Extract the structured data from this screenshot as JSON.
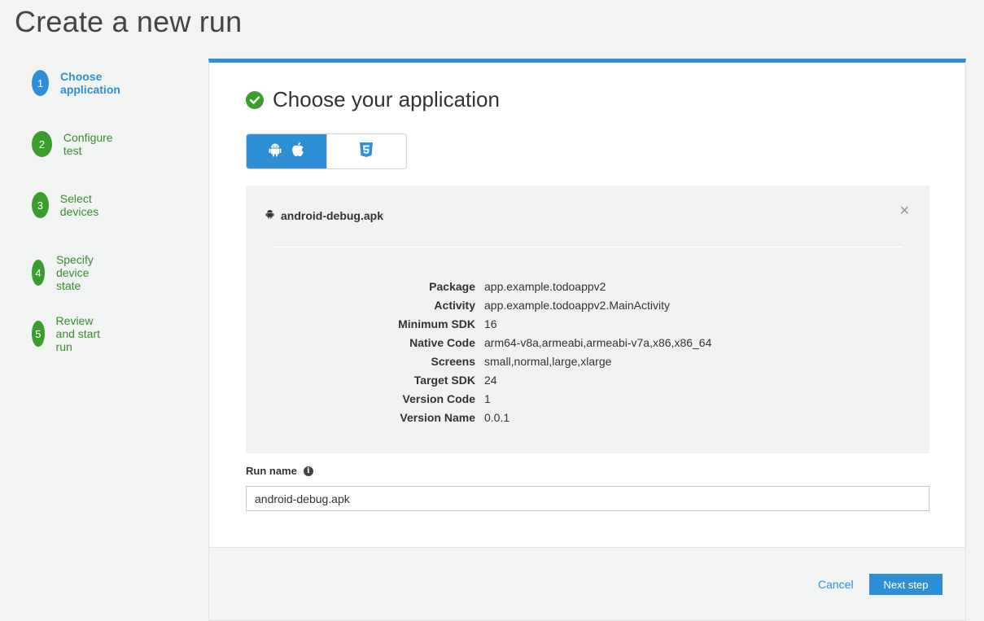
{
  "page": {
    "title": "Create a new run"
  },
  "steps": [
    {
      "number": "1",
      "label": "Choose application",
      "state": "active"
    },
    {
      "number": "2",
      "label": "Configure test",
      "state": "complete"
    },
    {
      "number": "3",
      "label": "Select devices",
      "state": "complete"
    },
    {
      "number": "4",
      "label": "Specify device state",
      "state": "complete"
    },
    {
      "number": "5",
      "label": "Review and start run",
      "state": "complete"
    }
  ],
  "main": {
    "title": "Choose your application",
    "title_icon": "check-circle-icon",
    "platform_toggle": {
      "options": [
        {
          "icons": [
            "android-icon",
            "apple-icon"
          ],
          "selected": true
        },
        {
          "icons": [
            "html5-icon"
          ],
          "selected": false
        }
      ]
    },
    "app": {
      "file_name": "android-debug.apk",
      "file_icon": "android-icon",
      "details": [
        {
          "key": "Package",
          "value": "app.example.todoappv2"
        },
        {
          "key": "Activity",
          "value": "app.example.todoappv2.MainActivity"
        },
        {
          "key": "Minimum SDK",
          "value": "16"
        },
        {
          "key": "Native Code",
          "value": "arm64-v8a,armeabi,armeabi-v7a,x86,x86_64"
        },
        {
          "key": "Screens",
          "value": "small,normal,large,xlarge"
        },
        {
          "key": "Target SDK",
          "value": "24"
        },
        {
          "key": "Version Code",
          "value": "1"
        },
        {
          "key": "Version Name",
          "value": "0.0.1"
        }
      ]
    },
    "run_name": {
      "label": "Run name",
      "info_glyph": "i",
      "value": "android-debug.apk"
    }
  },
  "footer": {
    "cancel_label": "Cancel",
    "next_label": "Next step"
  },
  "colors": {
    "accent": "#2f8fd6",
    "success": "#3b9d2e",
    "panel_bg": "#f1f1f1"
  }
}
